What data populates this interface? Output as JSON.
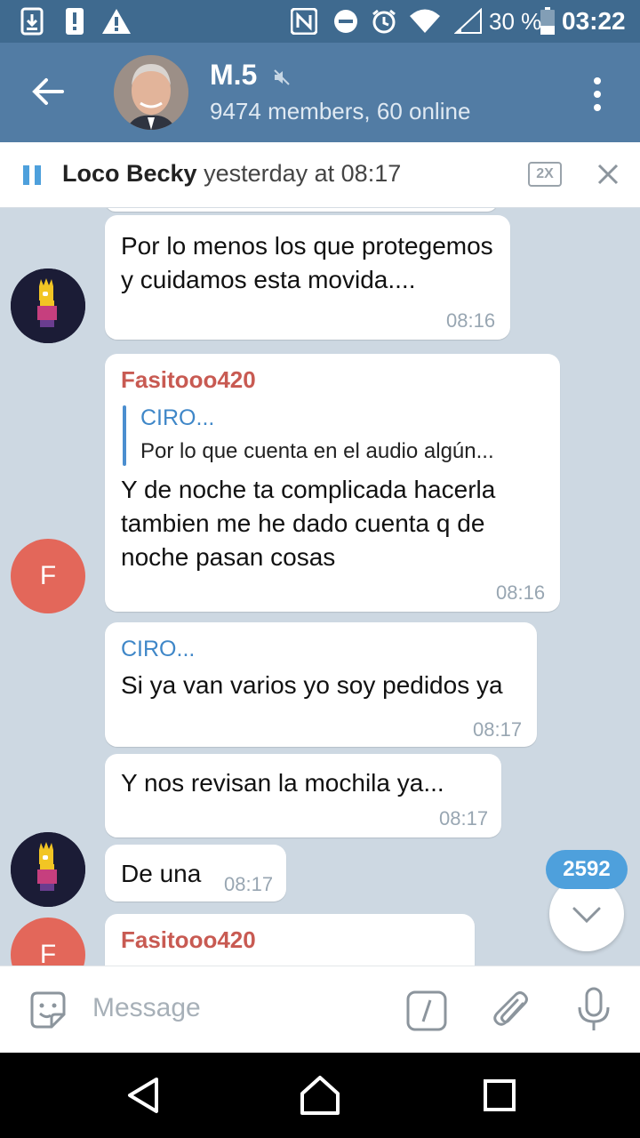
{
  "status_bar": {
    "battery": "30 %",
    "time": "03:22",
    "icons": [
      "download-icon",
      "alert-icon",
      "warning-icon",
      "nfc-icon",
      "dnd-icon",
      "alarm-icon",
      "wifi-icon",
      "signal-icon",
      "battery-icon"
    ]
  },
  "header": {
    "title": "M.5",
    "subtitle": "9474 members, 60 online",
    "icons": [
      "back-arrow-icon",
      "mute-icon",
      "kebab-menu-icon"
    ]
  },
  "pinned": {
    "name": "Loco Becky",
    "time": "yesterday at 08:17",
    "speed": "2X"
  },
  "messages": [
    {
      "text": "Por lo menos los que protegemos y cuidamos esta movida....",
      "time": "08:16"
    },
    {
      "sender": "Fasitooo420",
      "reply_name": "CIRO...",
      "reply_text": "Por lo que cuenta en el audio algún...",
      "text": "Y de noche ta complicada hacerla tambien me he dado cuenta q de noche pasan cosas",
      "time": "08:16",
      "avatar": "F"
    },
    {
      "reply_name": "CIRO...",
      "text": "Si ya van varios yo soy pedidos ya",
      "time": "08:17"
    },
    {
      "text": "Y nos revisan la mochila ya...",
      "time": "08:17"
    },
    {
      "text": "De una",
      "time": "08:17"
    },
    {
      "sender": "Fasitooo420",
      "avatar": "F"
    }
  ],
  "unread_badge": "2592",
  "input": {
    "placeholder": "Message"
  },
  "colors": {
    "header": "#527ca4",
    "status_bar": "#3f6a8f",
    "accent": "#4ea0dc",
    "sender": "#c85a52"
  }
}
